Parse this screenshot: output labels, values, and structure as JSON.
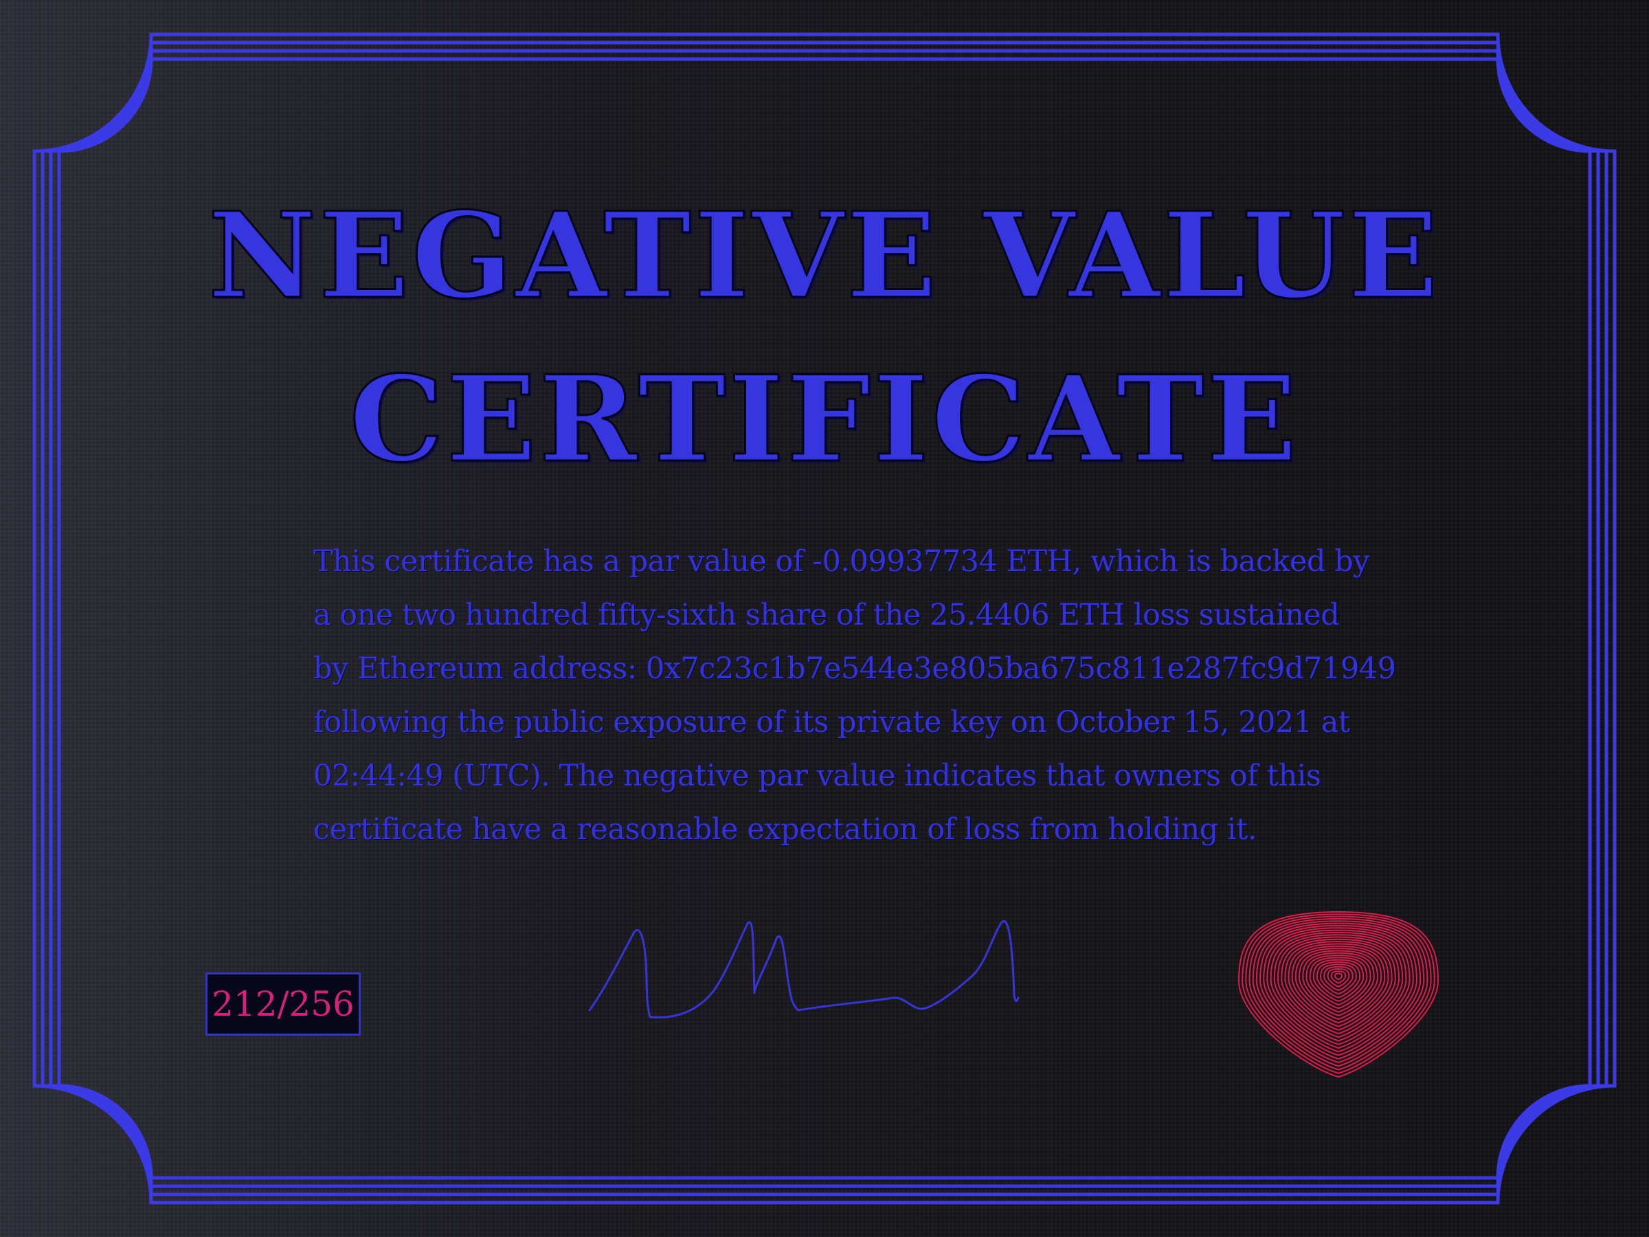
{
  "certificate": {
    "title_line_1": "NEGATIVE VALUE",
    "title_line_2": "CERTIFICATE",
    "body_lines": [
      "This certificate has a par value of -0.09937734 ETH, which is backed by",
      "a  one two hundred fifty-sixth  share of the 25.4406 ETH loss sustained",
      "by Ethereum address:   0x7c23c1b7e544e3e805ba675c811e287fc9d71949",
      "following the public exposure of its private key on  October 15, 2021  at",
      "02:44:49 (UTC).  The negative  par value  indicates that owners  of  this",
      "certificate have a reasonable expectation of loss from holding it."
    ],
    "edition": "212/256"
  },
  "colors": {
    "border": "#3a3ae6",
    "title": "#3636e0",
    "body_text": "#3333dd",
    "edition_text": "#d8207e",
    "seal": "#e01a4a",
    "background": "#16161c"
  },
  "icons": {
    "signature": "signature-scribble",
    "seal": "fingerprint-seal-icon"
  }
}
